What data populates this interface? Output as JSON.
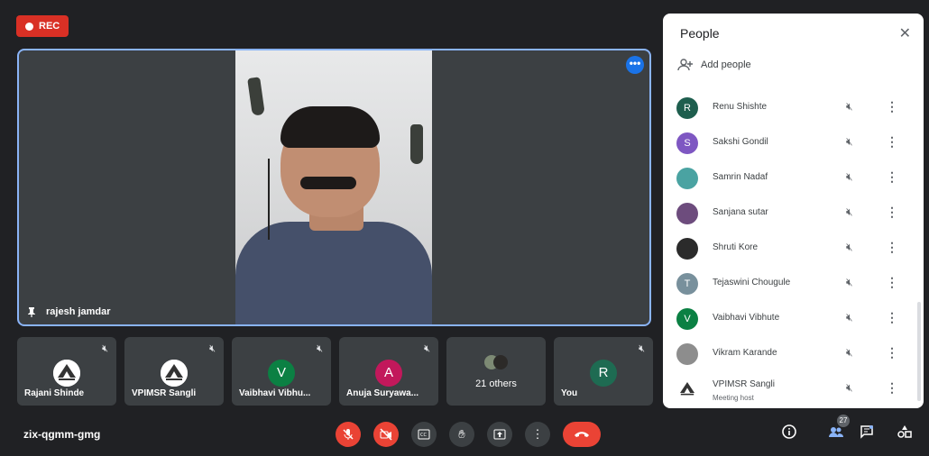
{
  "recording": {
    "label": "REC"
  },
  "main_speaker": {
    "name": "rajesh jamdar"
  },
  "thumbnails": [
    {
      "name": "Rajani Shinde",
      "avatar": "logo"
    },
    {
      "name": "VPIMSR Sangli",
      "avatar": "logo"
    },
    {
      "name": "Vaibhavi Vibhu...",
      "avatar": "V",
      "color": "#0b8043"
    },
    {
      "name": "Anuja Suryawa...",
      "avatar": "A",
      "color": "#c2185b"
    },
    {
      "name": "21 others",
      "avatar": "group"
    },
    {
      "name": "You",
      "avatar": "R",
      "color": "#1e6b52"
    }
  ],
  "meeting_code": "zix-qgmm-gmg",
  "participant_count": "27",
  "panel": {
    "title": "People",
    "add_people": "Add people",
    "participants": [
      {
        "name": "Renu Shishte",
        "initial": "R",
        "color": "#1e5e4e"
      },
      {
        "name": "Sakshi Gondil",
        "initial": "S",
        "color": "#7e57c2"
      },
      {
        "name": "Samrin Nadaf",
        "initial": "",
        "color": "#4aa3a2"
      },
      {
        "name": "Sanjana sutar",
        "initial": "",
        "color": "#6d4c7d"
      },
      {
        "name": "Shruti Kore",
        "initial": "",
        "color": "#2b2b2b"
      },
      {
        "name": "Tejaswini Chougule",
        "initial": "T",
        "color": "#78909c"
      },
      {
        "name": "Vaibhavi Vibhute",
        "initial": "V",
        "color": "#0b8043"
      },
      {
        "name": "Vikram Karande",
        "initial": "",
        "color": "#8d8d8d"
      },
      {
        "name": "VPIMSR Sangli",
        "initial": "",
        "color": "#ffffff",
        "subtitle": "Meeting host"
      }
    ]
  },
  "colors": {
    "accent": "#8ab4f8",
    "danger": "#ea4335",
    "rec": "#d93025",
    "background": "#202124",
    "tile": "#3c4043"
  }
}
